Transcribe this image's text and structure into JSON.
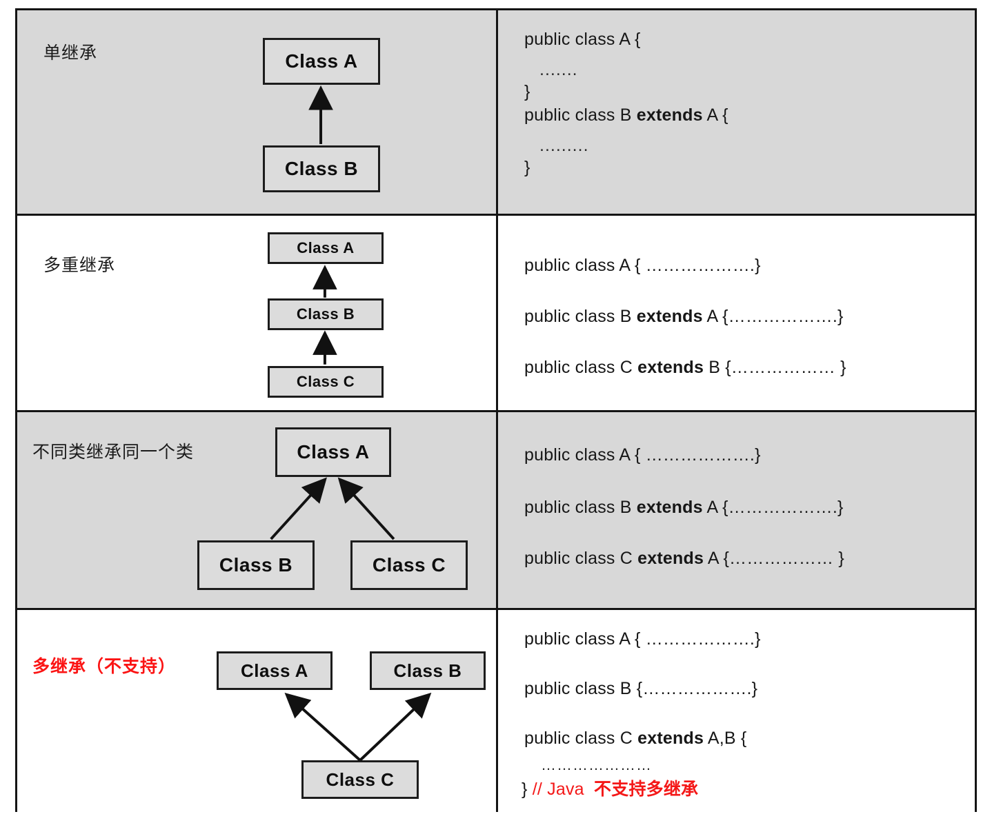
{
  "diagram": {
    "title_rows": [
      {
        "label": "单继承",
        "label_color": "#1b1b1b",
        "shaded": true,
        "boxes": [
          "Class A",
          "Class B"
        ],
        "relations": [
          "Class B -> Class A"
        ],
        "code": [
          "public class A {",
          ".......",
          "}",
          "public class B extends A {",
          ".........",
          "}"
        ]
      },
      {
        "label": "多重继承",
        "label_color": "#1b1b1b",
        "shaded": false,
        "boxes": [
          "Class A",
          "Class B",
          "Class C"
        ],
        "relations": [
          "Class C -> Class B",
          "Class B -> Class A"
        ],
        "code": [
          "public class A { ……………….}",
          "public class B extends A {……………….}",
          "public class C extends  B {……………… }"
        ]
      },
      {
        "label": "不同类继承同一个类",
        "label_color": "#1b1b1b",
        "shaded": true,
        "boxes": [
          "Class A",
          "Class B",
          "Class C"
        ],
        "relations": [
          "Class B -> Class A",
          "Class C -> Class A"
        ],
        "code": [
          "public class A { ……………….}",
          "public class B extends A {……………….}",
          "public class C extends A {……………… }"
        ]
      },
      {
        "label": "多继承（不支持）",
        "label_color": "#fb1414",
        "shaded": false,
        "boxes": [
          "Class A",
          "Class B",
          "Class C"
        ],
        "relations": [
          "Class C -> Class A",
          "Class C -> Class B"
        ],
        "code": [
          "public class A { ……………….}",
          "public class B {……………….}",
          "public class C extends  A,B {",
          "…………………",
          "} // Java  不支持多继承"
        ]
      }
    ],
    "row1": {
      "label": "单继承",
      "box_a": "Class A",
      "box_b": "Class B",
      "code_1": "public class A {",
      "code_2": ".......",
      "code_3": "}",
      "code_4_pre": "public class B ",
      "code_4_kw": "extends",
      "code_4_post": " A {",
      "code_5": ".........",
      "code_6": "}"
    },
    "row2": {
      "label": "多重继承",
      "box_a": "Class A",
      "box_b": "Class B",
      "box_c": "Class C",
      "code_1": "public class A { ……………….}",
      "code_2_pre": "public class B ",
      "code_2_kw": "extends",
      "code_2_post": " A {……………….}",
      "code_3_pre": "public class C ",
      "code_3_kw": "extends",
      "code_3_post": "  B {……………… }"
    },
    "row3": {
      "label": "不同类继承同一个类",
      "box_a": "Class A",
      "box_b": "Class B",
      "box_c": "Class C",
      "code_1": "public class A { ……………….}",
      "code_2_pre": "public class B ",
      "code_2_kw": "extends",
      "code_2_post": " A {……………….}",
      "code_3_pre": "public class C ",
      "code_3_kw": "extends",
      "code_3_post": " A {……………… }"
    },
    "row4": {
      "label": "多继承（不支持）",
      "box_a": "Class A",
      "box_b": "Class B",
      "box_c": "Class C",
      "code_1": "public class A { ……………….}",
      "code_2": "public class B {……………….}",
      "code_3_pre": "public class C ",
      "code_3_kw": "extends",
      "code_3_post": "  A,B {",
      "code_4": "…………………",
      "code_5_brace": "} ",
      "code_5_comment": "// Java",
      "code_5_cn": "不支持多继承"
    },
    "colors": {
      "shade": "#d8d8d8",
      "box_fill": "#dcdcdc",
      "border": "#141414",
      "red": "#fb1414",
      "text": "#171717"
    }
  }
}
